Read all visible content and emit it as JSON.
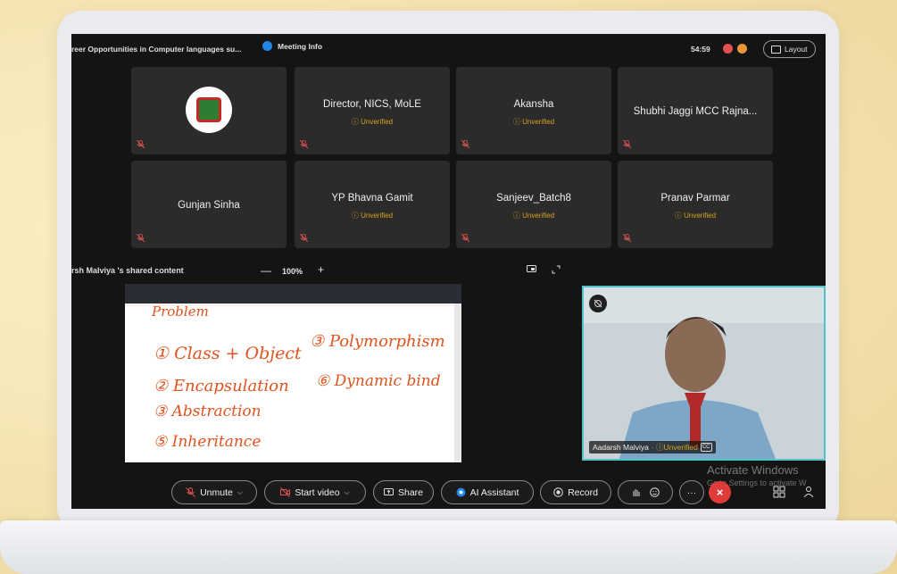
{
  "meeting": {
    "title": "reer Opportunities in Computer languages su...",
    "info_label": "Meeting Info",
    "timer": "54:59",
    "layout_label": "Layout"
  },
  "participants": [
    {
      "name": "",
      "status": ""
    },
    {
      "name": "Director, NICS, MoLE",
      "status": "Unverified"
    },
    {
      "name": "Akansha",
      "status": "Unverified"
    },
    {
      "name": "Shubhi Jaggi MCC Rajna...",
      "status": ""
    },
    {
      "name": "Gunjan Sinha",
      "status": ""
    },
    {
      "name": "YP Bhavna Gamit",
      "status": "Unverified"
    },
    {
      "name": "Sanjeev_Batch8",
      "status": "Unverified"
    },
    {
      "name": "Pranav Parmar",
      "status": "Unverified"
    }
  ],
  "share": {
    "label": "rsh Malviya 's shared content",
    "zoom": "100%",
    "minus": "—",
    "plus": "+"
  },
  "self_view": {
    "name": "Aadarsh Malviya",
    "status": "Unverified",
    "cc": "CC"
  },
  "watermark": {
    "title": "Activate Windows",
    "subtitle": "Go to Settings to activate W"
  },
  "toolbar": {
    "unmute": "Unmute",
    "start_video": "Start video",
    "share": "Share",
    "ai_assistant": "AI Assistant",
    "record": "Record",
    "more": "···",
    "end": "×"
  },
  "handwriting": [
    "Problem",
    "① Class + Object",
    "③ Polymorphism",
    "② Encapsulation",
    "⑥ Dynamic bind",
    "③ Abstraction",
    "⑤ Inheritance"
  ],
  "colors": {
    "accent": "#1e88e5",
    "end_call": "#e03b3b",
    "unverified": "#d8a21d",
    "ink": "#e0531e"
  }
}
